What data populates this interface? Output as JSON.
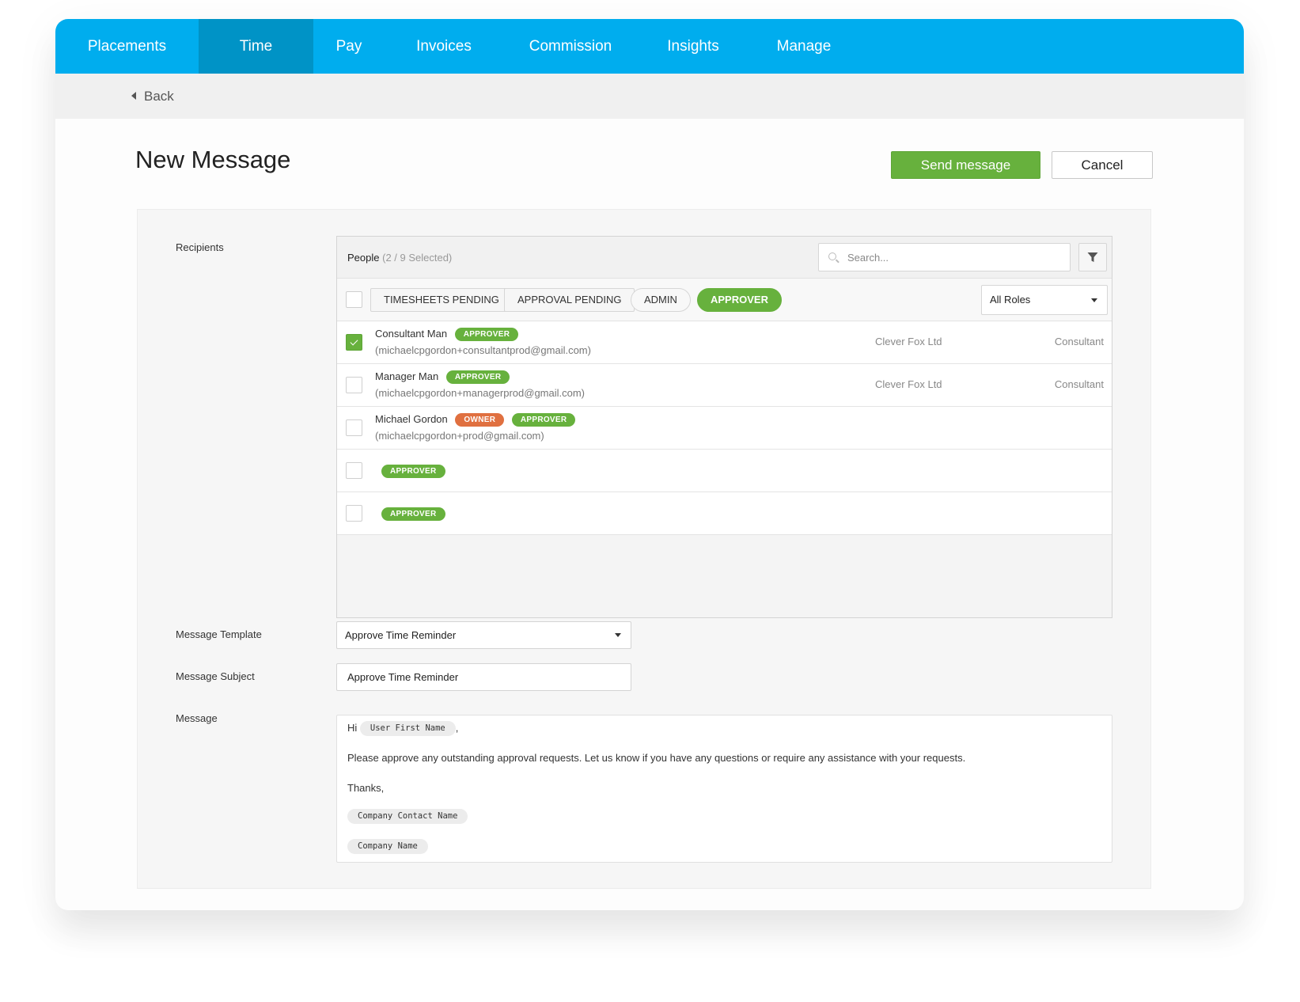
{
  "nav": {
    "items": [
      {
        "label": "Placements",
        "active": false
      },
      {
        "label": "Time",
        "active": true
      },
      {
        "label": "Pay",
        "active": false
      },
      {
        "label": "Invoices",
        "active": false
      },
      {
        "label": "Commission",
        "active": false
      },
      {
        "label": "Insights",
        "active": false
      },
      {
        "label": "Manage",
        "active": false
      }
    ],
    "color": "#00adee",
    "active_color": "#0093c6"
  },
  "back": {
    "label": "Back"
  },
  "page": {
    "title": "New Message",
    "send_label": "Send message",
    "cancel_label": "Cancel",
    "accent": "#67b13d"
  },
  "recipients": {
    "label": "Recipients",
    "people_title": "People",
    "people_count": "(2 / 9 Selected)",
    "search_placeholder": "Search...",
    "filters": [
      {
        "label": "TIMESHEETS PENDING",
        "active": false
      },
      {
        "label": "APPROVAL PENDING",
        "active": false
      },
      {
        "label": "ADMIN",
        "active": false
      },
      {
        "label": "APPROVER",
        "active": true
      }
    ],
    "roles_select": "All Roles",
    "rows": [
      {
        "name": "Consultant Man",
        "badges": [
          "APPROVER"
        ],
        "email": "(michaelcpgordon+consultantprod@gmail.com)",
        "company": "Clever Fox Ltd",
        "role": "Consultant",
        "checked": true
      },
      {
        "name": "Manager Man",
        "badges": [
          "APPROVER"
        ],
        "email": "(michaelcpgordon+managerprod@gmail.com)",
        "company": "Clever Fox Ltd",
        "role": "Consultant",
        "checked": false
      },
      {
        "name": "Michael Gordon",
        "badges": [
          "OWNER",
          "APPROVER"
        ],
        "email": "(michaelcpgordon+prod@gmail.com)",
        "company": "",
        "role": "",
        "checked": false
      },
      {
        "name": "",
        "badges": [
          "APPROVER"
        ],
        "email": "",
        "company": "",
        "role": "",
        "checked": false
      },
      {
        "name": "",
        "badges": [
          "APPROVER"
        ],
        "email": "",
        "company": "",
        "role": "",
        "checked": false
      }
    ]
  },
  "template": {
    "label": "Message Template",
    "value": "Approve Time Reminder"
  },
  "subject": {
    "label": "Message Subject",
    "value": "Approve Time Reminder"
  },
  "message": {
    "label": "Message",
    "greeting": "Hi",
    "greeting_token": "User First Name",
    "greeting_suffix": ",",
    "body": "Please approve any outstanding approval requests. Let us know if you have any questions or require any assistance with your requests.",
    "signoff": "Thanks,",
    "token_contact": "Company Contact Name",
    "token_company": "Company Name"
  }
}
